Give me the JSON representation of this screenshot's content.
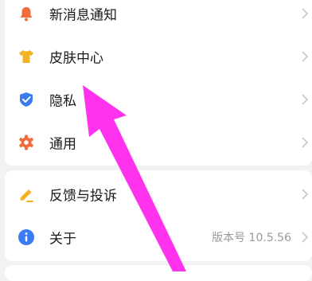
{
  "settings_group1": [
    {
      "label": "新消息通知",
      "icon": "bell-icon",
      "icon_color": "#f26b3a"
    },
    {
      "label": "皮肤中心",
      "icon": "tshirt-icon",
      "icon_color": "#f5b324"
    },
    {
      "label": "隐私",
      "icon": "shield-check-icon",
      "icon_color": "#3a7bf2"
    },
    {
      "label": "通用",
      "icon": "gear-icon",
      "icon_color": "#f26b3a"
    }
  ],
  "settings_group2": [
    {
      "label": "反馈与投诉",
      "icon": "pencil-icon",
      "icon_color": "#f5b324"
    },
    {
      "label": "关于",
      "icon": "info-icon",
      "icon_color": "#3a7bf2",
      "value": "版本号 10.5.56"
    }
  ],
  "annotation": {
    "type": "arrow",
    "color": "#ff33ee",
    "points_to": "隐私"
  }
}
